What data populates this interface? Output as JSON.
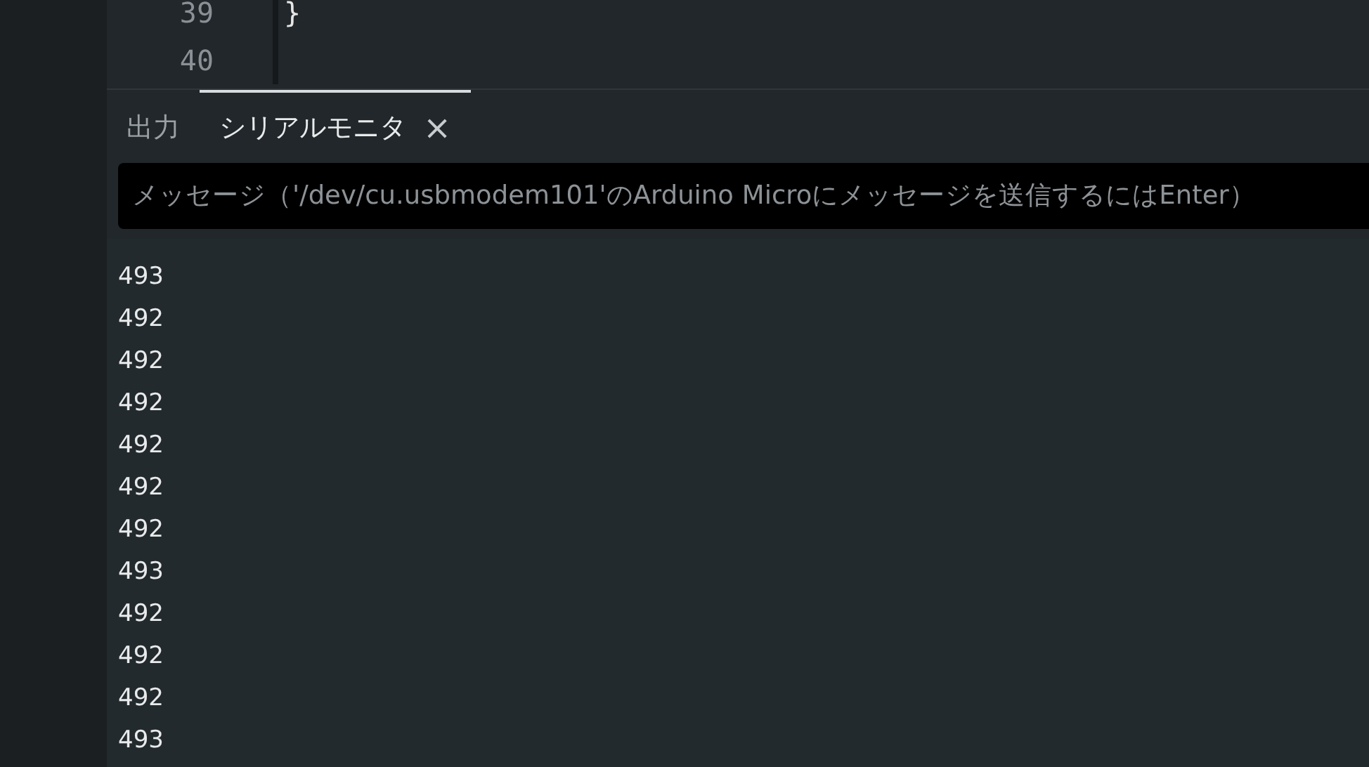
{
  "editor": {
    "lines": [
      {
        "number": "39",
        "code": "}"
      },
      {
        "number": "40"
      }
    ]
  },
  "panel": {
    "tabs": [
      {
        "label": "出力",
        "selected": false,
        "closable": false
      },
      {
        "label": "シリアルモニタ",
        "selected": true,
        "closable": true
      }
    ],
    "close_glyph": "×",
    "message_field": {
      "placeholder": "メッセージ（'/dev/cu.usbmodem101'のArduino Microにメッセージを送信するにはEnter）"
    },
    "output_lines": [
      "493",
      "492",
      "492",
      "492",
      "492",
      "492",
      "492",
      "493",
      "492",
      "492",
      "492",
      "493"
    ]
  }
}
